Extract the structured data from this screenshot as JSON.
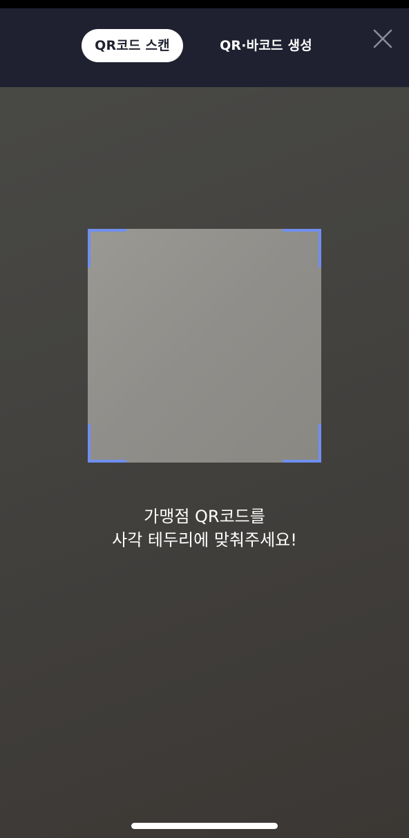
{
  "header": {
    "tabs": [
      {
        "label": "QR코드 스캔",
        "active": true
      },
      {
        "label": "QR·바코드 생성",
        "active": false
      }
    ],
    "close_icon": "close-icon"
  },
  "scanner": {
    "instruction_line1": "가맹점 QR코드를",
    "instruction_line2": "사각 테두리에 맞춰주세요!",
    "corner_color": "#6f8ff0"
  },
  "colors": {
    "header_bg": "#1f2130",
    "active_tab_bg": "#ffffff",
    "active_tab_text": "#1f2130",
    "accent": "#6f8ff0"
  }
}
